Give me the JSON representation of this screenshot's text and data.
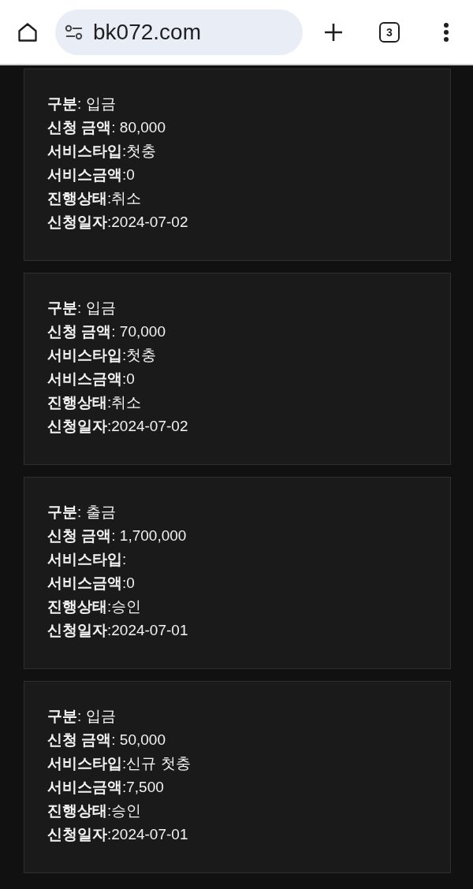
{
  "browser": {
    "url": "bk072.com",
    "tab_count": "3"
  },
  "records": [
    {
      "lines": [
        "**구분**: 입금",
        "**신청 금액**: 80,000",
        "**서비스타입**:첫충",
        "**서비스금액**:0",
        "**진행상태**:취소",
        "**신청일자**:2024-07-02"
      ]
    },
    {
      "lines": [
        "**구분**: 입금",
        "**신청 금액**: 70,000",
        "**서비스타입**:첫충",
        "**서비스금액**:0",
        "**진행상태**:취소",
        "**신청일자**:2024-07-02"
      ]
    },
    {
      "lines": [
        "**구분**: 출금",
        "**신청 금액**: 1,700,000",
        "**서비스타입**:",
        "**서비스금액**:0",
        "**진행상태**:승인",
        "**신청일자**:2024-07-01"
      ]
    },
    {
      "lines": [
        "**구분**: 입금",
        "**신청 금액**: 50,000",
        "**서비스타입**:신규 첫충",
        "**서비스금액**:7,500",
        "**진행상태**:승인",
        "**신청일자**:2024-07-01"
      ]
    }
  ]
}
